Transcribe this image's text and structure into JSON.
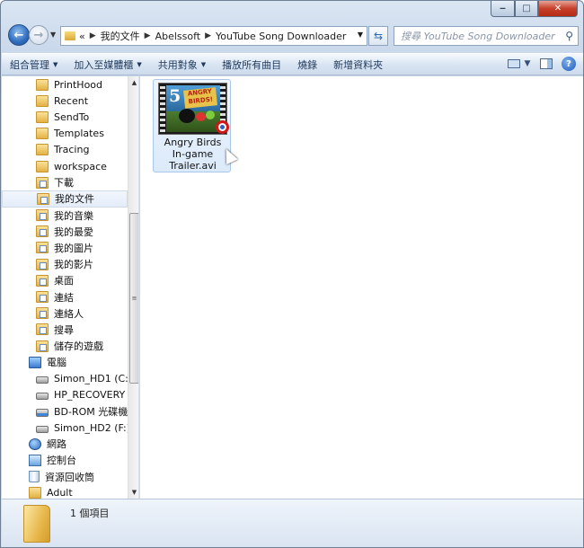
{
  "window": {
    "controls": {
      "minimize": "‒",
      "maximize": "□",
      "close": "✕"
    }
  },
  "address": {
    "chevron": "«",
    "path": [
      "我的文件",
      "Abelssoft",
      "YouTube Song Downloader"
    ]
  },
  "search": {
    "placeholder": "搜尋 YouTube Song Downloader"
  },
  "commands": [
    {
      "label": "組合管理",
      "dropdown": true
    },
    {
      "label": "加入至媒體櫃",
      "dropdown": true
    },
    {
      "label": "共用對象",
      "dropdown": true
    },
    {
      "label": "播放所有曲目",
      "dropdown": false
    },
    {
      "label": "燒錄",
      "dropdown": false
    },
    {
      "label": "新增資料夾",
      "dropdown": false
    }
  ],
  "nav": {
    "items": [
      {
        "label": "PrintHood",
        "icon": "folder-icon",
        "level": 1
      },
      {
        "label": "Recent",
        "icon": "folder-icon",
        "level": 1
      },
      {
        "label": "SendTo",
        "icon": "folder-icon",
        "level": 1
      },
      {
        "label": "Templates",
        "icon": "folder-icon",
        "level": 1
      },
      {
        "label": "Tracing",
        "icon": "folder-icon",
        "level": 1
      },
      {
        "label": "workspace",
        "icon": "folder-icon",
        "level": 1
      },
      {
        "label": "下載",
        "icon": "downloads-folder-icon",
        "level": 1
      },
      {
        "label": "我的文件",
        "icon": "documents-folder-icon",
        "level": 1,
        "selected": true
      },
      {
        "label": "我的音樂",
        "icon": "music-folder-icon",
        "level": 1
      },
      {
        "label": "我的最愛",
        "icon": "favorites-folder-icon",
        "level": 1
      },
      {
        "label": "我的圖片",
        "icon": "pictures-folder-icon",
        "level": 1
      },
      {
        "label": "我的影片",
        "icon": "videos-folder-icon",
        "level": 1
      },
      {
        "label": "桌面",
        "icon": "desktop-folder-icon",
        "level": 1
      },
      {
        "label": "連結",
        "icon": "links-folder-icon",
        "level": 1
      },
      {
        "label": "連絡人",
        "icon": "contacts-folder-icon",
        "level": 1
      },
      {
        "label": "搜尋",
        "icon": "searches-folder-icon",
        "level": 1
      },
      {
        "label": "儲存的遊戲",
        "icon": "saved-games-folder-icon",
        "level": 1
      },
      {
        "label": "電腦",
        "icon": "computer-icon",
        "level": 0
      },
      {
        "label": "Simon_HD1 (C:)",
        "icon": "hard-drive-icon",
        "level": 1
      },
      {
        "label": "HP_RECOVERY (D:",
        "icon": "hard-drive-icon",
        "level": 1
      },
      {
        "label": "BD-ROM 光碟機 (E",
        "icon": "optical-drive-icon",
        "level": 1
      },
      {
        "label": "Simon_HD2 (F:)",
        "icon": "hard-drive-icon",
        "level": 1
      },
      {
        "label": "網路",
        "icon": "network-icon",
        "level": 0
      },
      {
        "label": "控制台",
        "icon": "control-panel-icon",
        "level": 0
      },
      {
        "label": "資源回收筒",
        "icon": "recycle-bin-icon",
        "level": 0
      },
      {
        "label": "Adult",
        "icon": "folder-icon",
        "level": 0
      }
    ]
  },
  "file": {
    "name_lines": [
      "Angry Birds",
      "In-game",
      "Trailer.avi"
    ],
    "thumb_number": "5",
    "thumb_logo": "ANGRY BIRDS!"
  },
  "status": {
    "count": "1 個項目"
  }
}
